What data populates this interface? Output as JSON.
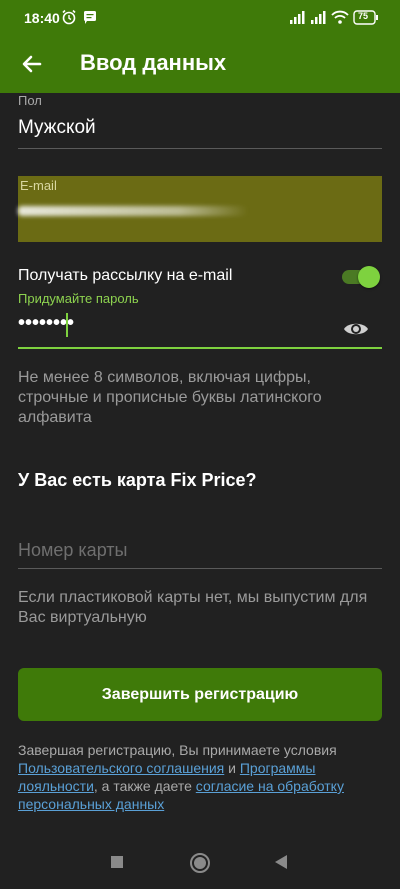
{
  "status_bar": {
    "time": "18:40",
    "battery": "75",
    "icons": [
      "alarm-icon",
      "message-icon",
      "signal-icon",
      "signal-icon",
      "wifi-icon",
      "battery-icon"
    ]
  },
  "app_bar": {
    "title": "Ввод данных",
    "back_icon": "arrow-left-icon",
    "background": "#3f7a09"
  },
  "form": {
    "gender": {
      "label": "Пол",
      "value": "Мужской"
    },
    "email": {
      "label": "E-mail",
      "highlight_color": "#6b6b14"
    },
    "newsletter": {
      "label": "Получать рассылку на e-mail",
      "enabled": true
    },
    "password": {
      "label": "Придумайте пароль",
      "value": "••••••••",
      "visibility_icon": "eye-icon",
      "hint": "Не менее 8 символов, включая цифры, строчные и прописные буквы латинского алфавита"
    },
    "card": {
      "heading": "У Вас есть карта Fix Price?",
      "placeholder": "Номер карты",
      "hint": "Если пластиковой карты нет, мы выпустим для Вас виртуальную"
    },
    "submit_label": "Завершить регистрацию",
    "legal": {
      "text_1": "Завершая регистрацию, Вы принимаете условия ",
      "link_1": "Пользовательского соглашения",
      "text_2": " и ",
      "link_2": "Программы лояльности",
      "text_3": ", а также даете ",
      "link_3": "согласие на обработку персональных данных"
    }
  },
  "colors": {
    "accent": "#7ed23f",
    "link": "#5aa0d6",
    "background": "#212121"
  },
  "nav_bar": {
    "icons": [
      "recent-apps-icon",
      "home-icon",
      "back-icon"
    ]
  }
}
